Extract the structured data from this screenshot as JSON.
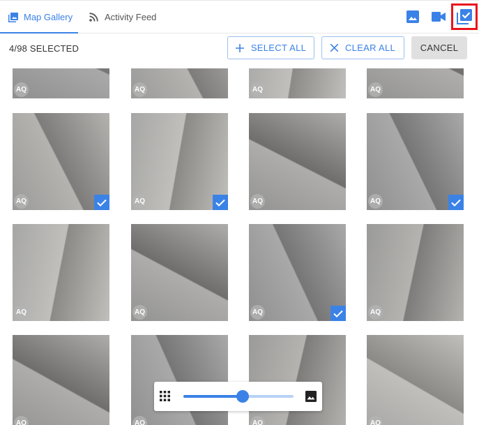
{
  "tabs": [
    {
      "label": "Map Gallery",
      "icon": "photo-library-icon",
      "active": true
    },
    {
      "label": "Activity Feed",
      "icon": "rss-feed-icon",
      "active": false
    }
  ],
  "toolbar_icons": [
    "image-filter-icon",
    "video-filter-icon",
    "select-mode-icon"
  ],
  "selection": {
    "count_label": "4/98 SELECTED",
    "select_all_label": "SELECT ALL",
    "clear_all_label": "CLEAR ALL",
    "cancel_label": "CANCEL"
  },
  "gallery": {
    "badge_text": "AQ",
    "rows": [
      [
        {
          "selected": false
        },
        {
          "selected": false
        },
        {
          "selected": false
        },
        {
          "selected": false
        }
      ],
      [
        {
          "selected": true
        },
        {
          "selected": true
        },
        {
          "selected": false
        },
        {
          "selected": true
        }
      ],
      [
        {
          "selected": false
        },
        {
          "selected": false
        },
        {
          "selected": true
        },
        {
          "selected": false
        }
      ],
      [
        {
          "selected": false
        },
        {
          "selected": false
        },
        {
          "selected": false
        },
        {
          "selected": false
        }
      ]
    ]
  },
  "zoom": {
    "level": 0.54
  },
  "colors": {
    "accent": "#3b82e6",
    "highlight_frame": "#e8141c",
    "cancel_bg": "#e0e0e0"
  }
}
